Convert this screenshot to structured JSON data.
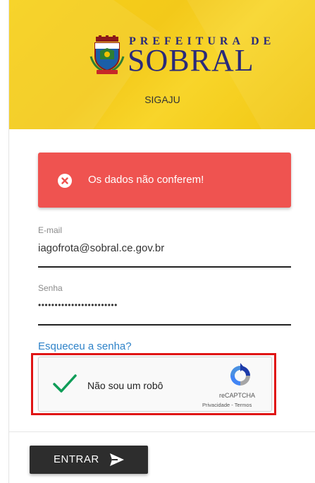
{
  "header": {
    "logo": {
      "top_text": "PREFEITURA DE",
      "main_text": "SOBRAL",
      "seal_icon": "sobral-coat-of-arms"
    },
    "app_name": "SIGAJU"
  },
  "alert": {
    "icon": "close-circle-icon",
    "message": "Os dados não conferem!",
    "color": "#ef5350"
  },
  "form": {
    "email": {
      "label": "E-mail",
      "value": "iagofrota@sobral.ce.gov.br"
    },
    "password": {
      "label": "Senha",
      "value": "••••••••••••••••••••••••"
    },
    "forgot_link": "Esqueceu a senha?",
    "captcha": {
      "checked": true,
      "label": "Não sou um robô",
      "brand": "reCAPTCHA",
      "privacy": "Privacidade",
      "separator": " - ",
      "terms": "Termos"
    },
    "submit": {
      "label": "ENTRAR",
      "icon": "send-icon"
    }
  },
  "colors": {
    "header_yellow": "#f5cd1a",
    "alert_red": "#ef5350",
    "link_blue": "#2f83c9",
    "button_dark": "#2d2d2d",
    "highlight_red": "#e01515",
    "check_green": "#0f9d58"
  }
}
